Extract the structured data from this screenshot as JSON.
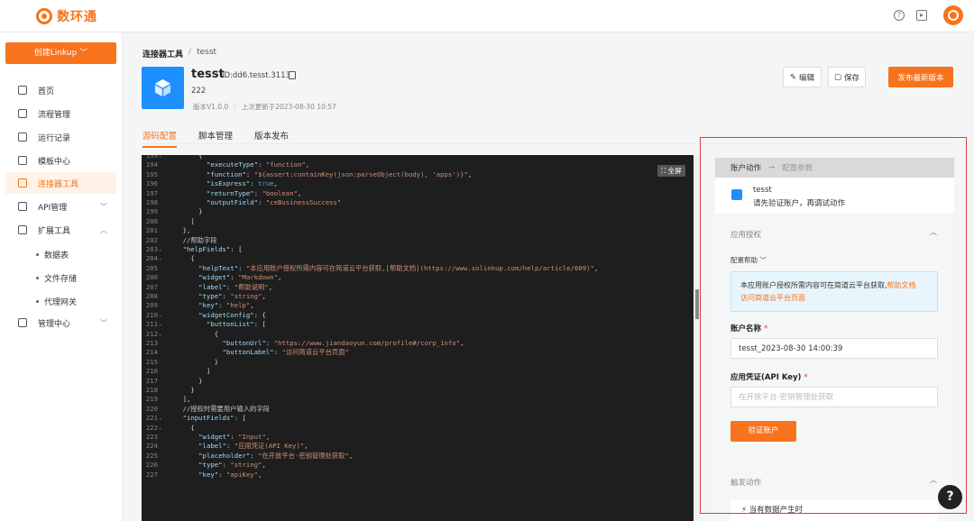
{
  "app": {
    "name": "数环通"
  },
  "sidebar": {
    "create_button": "创建Linkup ﹀",
    "items": [
      {
        "label": "首页"
      },
      {
        "label": "流程管理"
      },
      {
        "label": "运行记录"
      },
      {
        "label": "模板中心"
      },
      {
        "label": "连接器工具"
      },
      {
        "label": "API管理"
      },
      {
        "label": "扩展工具"
      },
      {
        "label": "管理中心"
      }
    ],
    "sub_items": [
      {
        "label": "数据表"
      },
      {
        "label": "文件存储"
      },
      {
        "label": "代理网关"
      }
    ]
  },
  "header": {
    "breadcrumb_root": "连接器工具",
    "breadcrumb_sep": "/",
    "breadcrumb_current": "tesst",
    "connector_name": "tesst",
    "connector_id": "ID:dd6.tesst.3113",
    "connector_desc": "222",
    "version": "版本V1.0.0",
    "updated": "上次更新于2023-08-30 10:57",
    "edit_label": "编辑",
    "save_label": "保存",
    "publish_label": "发布最新版本"
  },
  "tabs": [
    {
      "label": "源码配置",
      "active": true
    },
    {
      "label": "脚本管理",
      "active": false
    },
    {
      "label": "版本发布",
      "active": false
    }
  ],
  "editor": {
    "fullscreen_label": "全屏",
    "lines": [
      {
        "n": "193",
        "fold": true,
        "text": "        {"
      },
      {
        "n": "194",
        "fold": false,
        "text": "          \"executeType\": \"function\","
      },
      {
        "n": "195",
        "fold": false,
        "text": "          \"function\": \"${assert:containKey(json:parseObject(body), 'apps')}\","
      },
      {
        "n": "196",
        "fold": false,
        "text": "          \"isExpress\": true,"
      },
      {
        "n": "197",
        "fold": false,
        "text": "          \"returnType\": \"boolean\","
      },
      {
        "n": "198",
        "fold": false,
        "text": "          \"outputField\": \"ceBusinessSuccess\""
      },
      {
        "n": "199",
        "fold": false,
        "text": "        }"
      },
      {
        "n": "200",
        "fold": false,
        "text": "      ]"
      },
      {
        "n": "201",
        "fold": false,
        "text": "    },"
      },
      {
        "n": "202",
        "fold": false,
        "text": "    //帮助字段"
      },
      {
        "n": "203",
        "fold": true,
        "text": "    \"helpFields\": ["
      },
      {
        "n": "204",
        "fold": true,
        "text": "      {"
      },
      {
        "n": "205",
        "fold": false,
        "text": "        \"helpText\": \"本应用账户授权所需内容可在简道云平台获取,[帮助文档](https://www.solinkup.com/help/article/609)\","
      },
      {
        "n": "206",
        "fold": false,
        "text": "        \"widget\": \"Markdown\","
      },
      {
        "n": "207",
        "fold": false,
        "text": "        \"label\": \"帮助说明\","
      },
      {
        "n": "208",
        "fold": false,
        "text": "        \"type\": \"string\","
      },
      {
        "n": "209",
        "fold": false,
        "text": "        \"key\": \"help\","
      },
      {
        "n": "210",
        "fold": true,
        "text": "        \"widgetConfig\": {"
      },
      {
        "n": "211",
        "fold": true,
        "text": "          \"buttonList\": ["
      },
      {
        "n": "212",
        "fold": true,
        "text": "            {"
      },
      {
        "n": "213",
        "fold": false,
        "text": "              \"buttonUrl\": \"https://www.jiandaoyun.com/profile#/corp_info\","
      },
      {
        "n": "214",
        "fold": false,
        "text": "              \"buttonLabel\": \"访问简道云平台页面\""
      },
      {
        "n": "215",
        "fold": false,
        "text": "            }"
      },
      {
        "n": "216",
        "fold": false,
        "text": "          ]"
      },
      {
        "n": "217",
        "fold": false,
        "text": "        }"
      },
      {
        "n": "218",
        "fold": false,
        "text": "      }"
      },
      {
        "n": "219",
        "fold": false,
        "text": "    ],"
      },
      {
        "n": "220",
        "fold": false,
        "text": "    //授权时需要用户输入的字段"
      },
      {
        "n": "221",
        "fold": true,
        "text": "    \"inputFields\": ["
      },
      {
        "n": "222",
        "fold": true,
        "text": "      {"
      },
      {
        "n": "223",
        "fold": false,
        "text": "        \"widget\": \"Input\","
      },
      {
        "n": "224",
        "fold": false,
        "text": "        \"label\": \"应用凭证(API Key)\","
      },
      {
        "n": "225",
        "fold": false,
        "text": "        \"placeholder\": \"在开放平台-密钥管理处获取\","
      },
      {
        "n": "226",
        "fold": false,
        "text": "        \"type\": \"string\","
      },
      {
        "n": "227",
        "fold": false,
        "text": "        \"key\": \"apiKey\","
      }
    ]
  },
  "panel": {
    "step1": "账户动作",
    "step_arrow": "→",
    "step2": "配置参数",
    "account_name": "tesst",
    "account_tip": "请先验证账户，再调试动作",
    "section_auth": "应用授权",
    "help_label": "配置帮助 ﹀",
    "help_text": "本应用账户授权所需内容可在简道云平台获取,",
    "help_link1": "帮助文档",
    "help_link2": "访问简道云平台页面",
    "field_account_label": "账户名称",
    "field_account_value": "tesst_2023-08-30 14:00:39",
    "field_key_label": "应用凭证(API Key)",
    "field_key_placeholder": "在开放平台-密钥管理处获取",
    "required_mark": "*",
    "verify_button": "验证账户",
    "section_trigger": "触发动作",
    "trigger_item": "当有数据产生时"
  },
  "colors": {
    "accent": "#f7731c",
    "brand_blue": "#1e8fff",
    "highlight_frame": "#e53935"
  }
}
